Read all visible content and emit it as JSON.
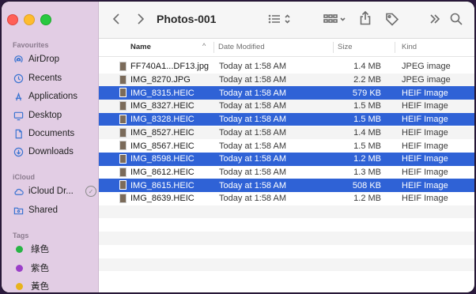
{
  "window": {
    "title": "Photos-001"
  },
  "sidebar": {
    "sections": {
      "favourites": "Favourites",
      "icloud": "iCloud",
      "tags": "Tags"
    },
    "favourites": [
      {
        "label": "AirDrop",
        "icon": "airdrop-icon"
      },
      {
        "label": "Recents",
        "icon": "clock-icon"
      },
      {
        "label": "Applications",
        "icon": "applications-icon"
      },
      {
        "label": "Desktop",
        "icon": "desktop-icon"
      },
      {
        "label": "Documents",
        "icon": "document-icon"
      },
      {
        "label": "Downloads",
        "icon": "download-icon"
      }
    ],
    "icloud": [
      {
        "label": "iCloud Dr...",
        "icon": "cloud-icon"
      },
      {
        "label": "Shared",
        "icon": "shared-folder-icon"
      }
    ],
    "tags": [
      {
        "label": "綠色",
        "color": "#28b446"
      },
      {
        "label": "紫色",
        "color": "#9b3fc8"
      },
      {
        "label": "黃色",
        "color": "#e8b31c"
      }
    ]
  },
  "columns": {
    "name": "Name",
    "date": "Date Modified",
    "size": "Size",
    "kind": "Kind"
  },
  "files": [
    {
      "name": "FF740A1...DF13.jpg",
      "date": "Today at 1:58 AM",
      "size": "1.4 MB",
      "kind": "JPEG image",
      "selected": false
    },
    {
      "name": "IMG_8270.JPG",
      "date": "Today at 1:58 AM",
      "size": "2.2 MB",
      "kind": "JPEG image",
      "selected": false
    },
    {
      "name": "IMG_8315.HEIC",
      "date": "Today at 1:58 AM",
      "size": "579 KB",
      "kind": "HEIF Image",
      "selected": true
    },
    {
      "name": "IMG_8327.HEIC",
      "date": "Today at 1:58 AM",
      "size": "1.5 MB",
      "kind": "HEIF Image",
      "selected": false
    },
    {
      "name": "IMG_8328.HEIC",
      "date": "Today at 1:58 AM",
      "size": "1.5 MB",
      "kind": "HEIF Image",
      "selected": true
    },
    {
      "name": "IMG_8527.HEIC",
      "date": "Today at 1:58 AM",
      "size": "1.4 MB",
      "kind": "HEIF Image",
      "selected": false
    },
    {
      "name": "IMG_8567.HEIC",
      "date": "Today at 1:58 AM",
      "size": "1.5 MB",
      "kind": "HEIF Image",
      "selected": false
    },
    {
      "name": "IMG_8598.HEIC",
      "date": "Today at 1:58 AM",
      "size": "1.2 MB",
      "kind": "HEIF Image",
      "selected": true
    },
    {
      "name": "IMG_8612.HEIC",
      "date": "Today at 1:58 AM",
      "size": "1.3 MB",
      "kind": "HEIF Image",
      "selected": false
    },
    {
      "name": "IMG_8615.HEIC",
      "date": "Today at 1:58 AM",
      "size": "508 KB",
      "kind": "HEIF Image",
      "selected": true
    },
    {
      "name": "IMG_8639.HEIC",
      "date": "Today at 1:58 AM",
      "size": "1.2 MB",
      "kind": "HEIF Image",
      "selected": false
    }
  ],
  "colors": {
    "selection": "#2f62d6",
    "sidebar": "#e2cde4"
  }
}
